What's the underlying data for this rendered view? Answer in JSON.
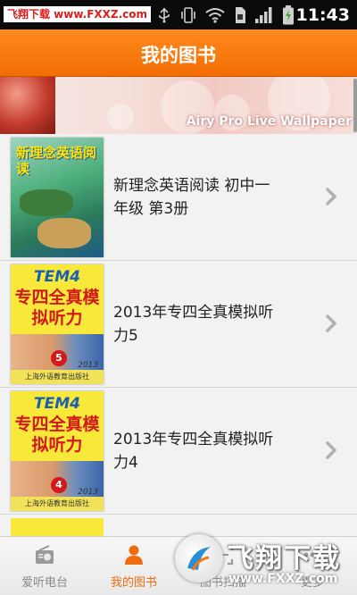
{
  "status_bar": {
    "watermark_text": "飞翔下载 www.FXXZ.com",
    "time": "11:43",
    "icons": [
      "usb-icon",
      "vibrate-icon",
      "wifi-icon",
      "sim-icon",
      "signal-icon",
      "battery-icon"
    ]
  },
  "header": {
    "title": "我的图书"
  },
  "ad_banner": {
    "text": "Airy Pro Live Wallpaper"
  },
  "books": [
    {
      "title_line1": "新理念英语阅读 初中一",
      "title_line2": "年级 第3册",
      "cover_title": "新理念英语阅读",
      "cover": "green"
    },
    {
      "title_line1": "2013年专四全真模拟听",
      "title_line2": "力5",
      "cover_brand": "TEM4",
      "cover_title": "专四全真模拟听力",
      "cover_number": "5",
      "cover_year": "2013",
      "cover_publisher": "上海外语教育出版社"
    },
    {
      "title_line1": "2013年专四全真模拟听",
      "title_line2": "力4",
      "cover_brand": "TEM4",
      "cover_title": "专四全真模拟听力",
      "cover_number": "4",
      "cover_year": "2013",
      "cover_publisher": "上海外语教育出版社"
    }
  ],
  "tabs": [
    {
      "label": "爱听电台",
      "icon": "radio-icon"
    },
    {
      "label": "我的图书",
      "icon": "person-icon",
      "active": true
    },
    {
      "label": "图书扫描",
      "icon": "scan-icon"
    },
    {
      "label": "更多",
      "icon": "more-icon"
    }
  ],
  "watermark": {
    "text": "飞翔下载",
    "url": "www.FXXZ.com"
  },
  "colors": {
    "accent": "#f47a0e",
    "active_tab": "#ee6b10",
    "list_bg": "#f2f2f2"
  }
}
